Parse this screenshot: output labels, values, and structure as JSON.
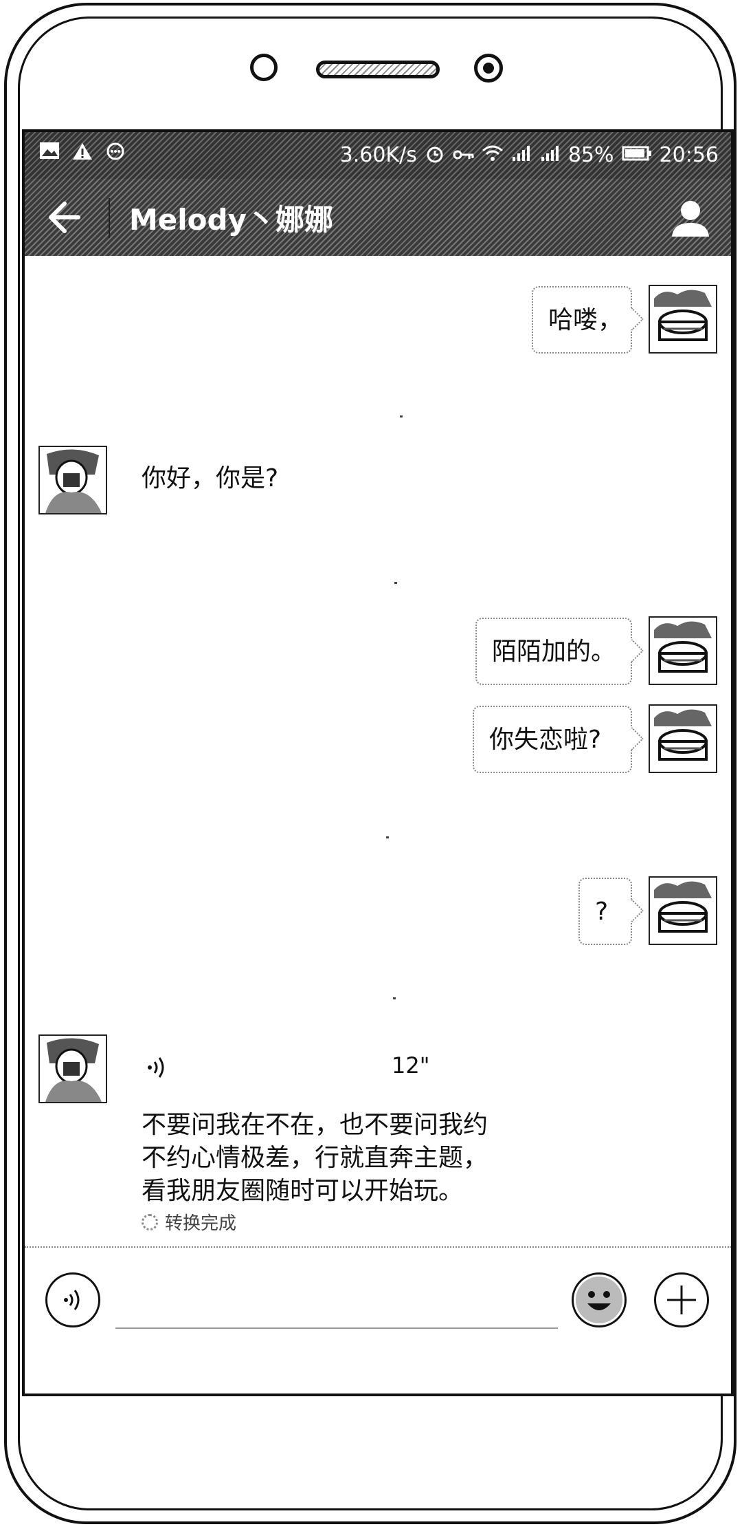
{
  "status_bar": {
    "left_icons": [
      "image-icon",
      "warning-icon",
      "chat-bubble-icon"
    ],
    "speed": "3.60K/s",
    "battery": "85%",
    "time": "20:56",
    "right_icons": [
      "alarm-icon",
      "key-icon",
      "wifi-icon",
      "signal-icon",
      "signal-icon",
      "battery-icon"
    ]
  },
  "header": {
    "title": "Melody丶娜娜",
    "back_icon": "arrow-left-icon",
    "profile_icon": "person-icon"
  },
  "messages": [
    {
      "side": "right",
      "type": "text",
      "text": "哈喽，"
    },
    {
      "side": "left",
      "type": "text",
      "text": "你好，你是?"
    },
    {
      "side": "right",
      "type": "text",
      "text": "陌陌加的。"
    },
    {
      "side": "right",
      "type": "text",
      "text": "你失恋啦?"
    },
    {
      "side": "right",
      "type": "text",
      "text": "?"
    },
    {
      "side": "left",
      "type": "voice",
      "duration": "12\"",
      "transcript_lines": [
        "不要问我在不在，也不要问我约",
        "不约心情极差，行就直奔主题，",
        "看我朋友圈随时可以开始玩。"
      ],
      "convert_status": "转换完成"
    }
  ],
  "input_bar": {
    "voice_icon": "voice-icon",
    "emoji_icon": "emoji-icon",
    "plus_icon": "plus-icon",
    "text_value": "",
    "placeholder": ""
  }
}
